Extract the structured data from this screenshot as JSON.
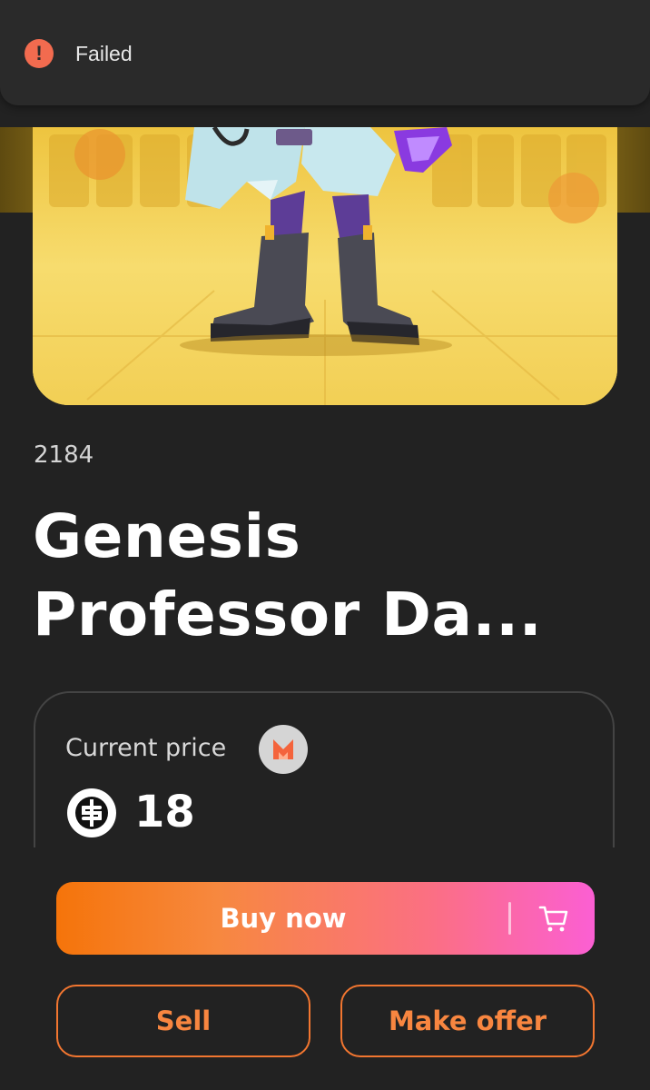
{
  "toast": {
    "icon": "error-icon",
    "message": "Failed",
    "color": "#f26b4f"
  },
  "item": {
    "token_id": "2184",
    "title": "Genesis Professor Da..."
  },
  "price": {
    "label": "Current price",
    "marketplace_icon": "marketplace-logo-icon",
    "currency_icon": "dollar-coin-icon",
    "value": "18"
  },
  "actions": {
    "buy_label": "Buy now",
    "cart_icon": "cart-icon",
    "sell_label": "Sell",
    "offer_label": "Make offer"
  },
  "colors": {
    "background": "#222222",
    "accent_orange": "#f5740a",
    "accent_pink": "#fb5fd3",
    "outline": "#f27630"
  }
}
